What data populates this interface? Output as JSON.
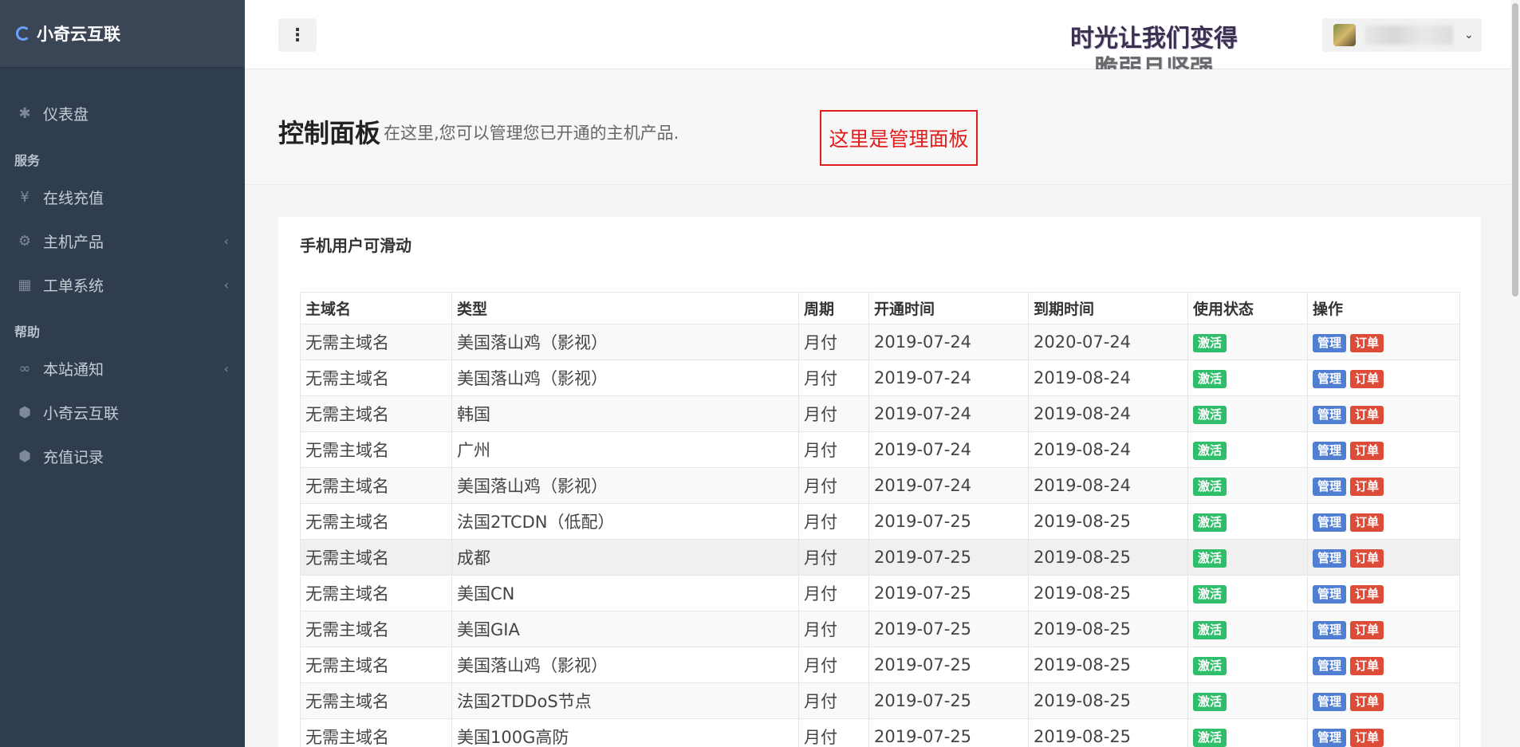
{
  "brand": {
    "name": "小奇云互联"
  },
  "sidebar": {
    "items": [
      {
        "label": "仪表盘",
        "icon": "asterisk-icon"
      },
      {
        "section": "服务"
      },
      {
        "label": "在线充值",
        "icon": "yen-icon"
      },
      {
        "label": "主机产品",
        "icon": "cogs-icon",
        "caret": true
      },
      {
        "label": "工单系统",
        "icon": "calendar-icon",
        "caret": true
      },
      {
        "section": "帮助"
      },
      {
        "label": "本站通知",
        "icon": "handshake-icon",
        "caret": true
      },
      {
        "label": "小奇云互联",
        "icon": "cube-icon"
      },
      {
        "label": "充值记录",
        "icon": "cube-icon"
      }
    ],
    "labels": {
      "dashboard": "仪表盘",
      "section_services": "服务",
      "recharge": "在线充值",
      "hosts": "主机产品",
      "tickets": "工单系统",
      "section_help": "帮助",
      "notices": "本站通知",
      "site": "小奇云互联",
      "records": "充值记录"
    }
  },
  "header": {
    "slogan_line1": "时光让我们变得",
    "slogan_line2": "脆弱且坚强"
  },
  "page": {
    "title": "控制面板",
    "subtitle": "在这里,您可以管理您已开通的主机产品.",
    "notice": "这里是管理面板"
  },
  "card": {
    "title": "手机用户可滑动",
    "columns": [
      "主域名",
      "类型",
      "周期",
      "开通时间",
      "到期时间",
      "使用状态",
      "操作"
    ],
    "rows": [
      [
        "无需主域名",
        "美国落山鸡（影视）",
        "月付",
        "2019-07-24",
        "2020-07-24"
      ],
      [
        "无需主域名",
        "美国落山鸡（影视）",
        "月付",
        "2019-07-24",
        "2019-08-24"
      ],
      [
        "无需主域名",
        "韩国",
        "月付",
        "2019-07-24",
        "2019-08-24"
      ],
      [
        "无需主域名",
        "广州",
        "月付",
        "2019-07-24",
        "2019-08-24"
      ],
      [
        "无需主域名",
        "美国落山鸡（影视）",
        "月付",
        "2019-07-24",
        "2019-08-24"
      ],
      [
        "无需主域名",
        "法国2TCDN（低配）",
        "月付",
        "2019-07-25",
        "2019-08-25"
      ],
      [
        "无需主域名",
        "成都",
        "月付",
        "2019-07-25",
        "2019-08-25"
      ],
      [
        "无需主域名",
        "美国CN",
        "月付",
        "2019-07-25",
        "2019-08-25"
      ],
      [
        "无需主域名",
        "美国GIA",
        "月付",
        "2019-07-25",
        "2019-08-25"
      ],
      [
        "无需主域名",
        "美国落山鸡（影视）",
        "月付",
        "2019-07-25",
        "2019-08-25"
      ],
      [
        "无需主域名",
        "法国2TDDoS节点",
        "月付",
        "2019-07-25",
        "2019-08-25"
      ],
      [
        "无需主域名",
        "美国100G高防",
        "月付",
        "2019-07-25",
        "2019-08-25"
      ]
    ],
    "status_label": "激活",
    "manage_label": "管理",
    "order_label": "订单"
  },
  "colors": {
    "sidebar_bg": "#2f3d4f",
    "status_green": "#2fbf6b",
    "manage_blue": "#4f7ed3",
    "order_red": "#dd4b39",
    "notice_red": "#e21d1d"
  }
}
